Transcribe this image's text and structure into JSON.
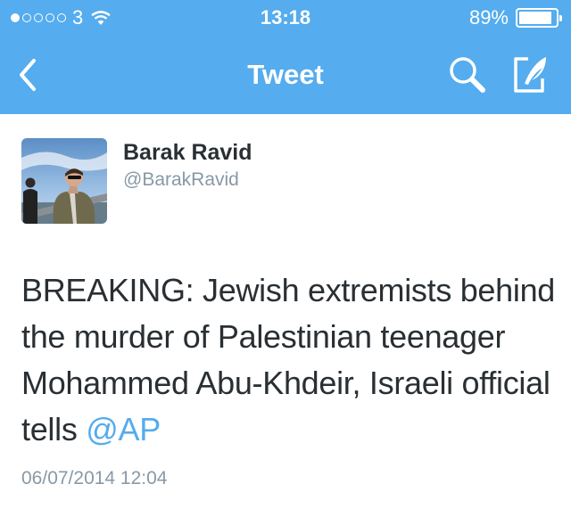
{
  "status_bar": {
    "carrier": "3",
    "time": "13:18",
    "battery": "89%",
    "battery_level": 0.89,
    "signal_bars_filled": 1,
    "signal_bars_total": 5
  },
  "nav": {
    "title": "Tweet",
    "back_icon": "chevron-left-icon",
    "search_icon": "search-icon",
    "compose_icon": "compose-icon"
  },
  "tweet": {
    "author_name": "Barak Ravid",
    "author_handle": "@BarakRavid",
    "text": "BREAKING: Jewish extremists behind the murder of Palestinian teenager Mohammed Abu-Khdeir, Israeli official tells ",
    "mention": "@AP",
    "timestamp": "06/07/2014 12:04"
  },
  "colors": {
    "brand": "#55acee",
    "text": "#292f33",
    "muted": "#8899a6"
  }
}
